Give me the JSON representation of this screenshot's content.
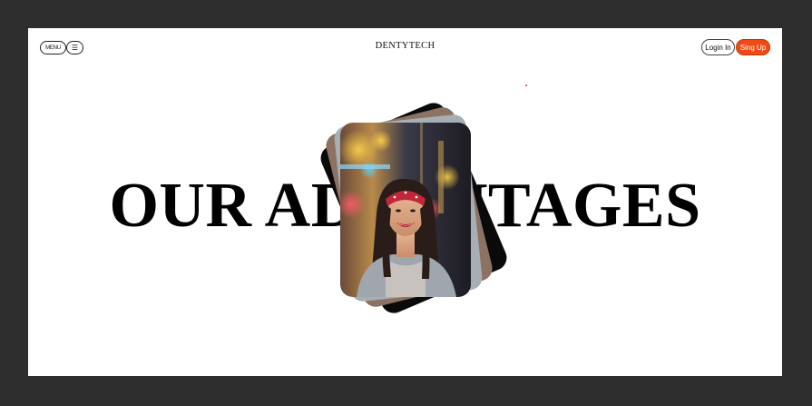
{
  "header": {
    "menu_label": "MENU",
    "burger_icon": "☰",
    "brand": "DENTYTECH",
    "login_label": "Login In",
    "signup_label": "Sing Up"
  },
  "hero": {
    "headline": "OUR ADVANTAGES"
  },
  "colors": {
    "page_bg": "#2e2e2e",
    "canvas_bg": "#ffffff",
    "accent": "#f04a13"
  },
  "icons": [
    "menu-icon",
    "hamburger-icon"
  ]
}
